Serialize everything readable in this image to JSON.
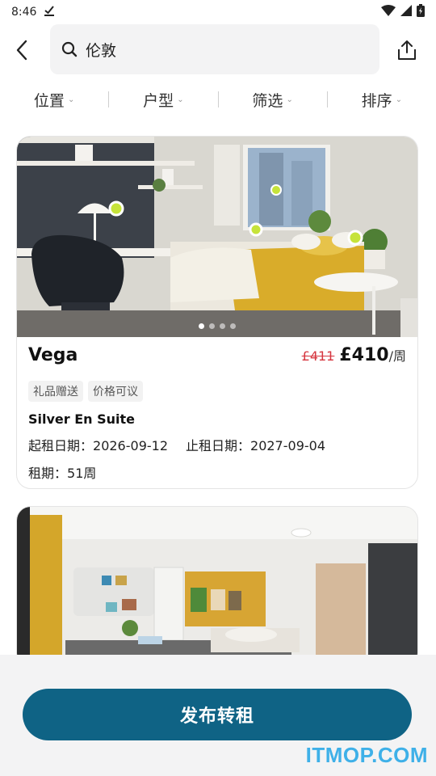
{
  "status_bar": {
    "time": "8:46"
  },
  "search": {
    "query": "伦敦"
  },
  "filters": [
    {
      "label": "位置"
    },
    {
      "label": "户型"
    },
    {
      "label": "筛选"
    },
    {
      "label": "排序"
    }
  ],
  "listings": [
    {
      "name": "Vega",
      "old_price": "£411",
      "price": "£410",
      "unit": "/周",
      "tags": [
        "礼品赠送",
        "价格可议"
      ],
      "room_type": "Silver En Suite",
      "start_label": "起租日期：",
      "start_date": "2026-09-12",
      "end_label": "止租日期：",
      "end_date": "2027-09-04",
      "term_label": "租期：",
      "term": "51周",
      "photo_count": 4,
      "active_photo": 1
    }
  ],
  "publish_button": "发布转租",
  "watermark": "ITMOP.COM",
  "colors": {
    "accent": "#0f6385",
    "old_price": "#d6363f",
    "watermark": "#3eb0e8",
    "hotspot": "#c6e33a"
  }
}
